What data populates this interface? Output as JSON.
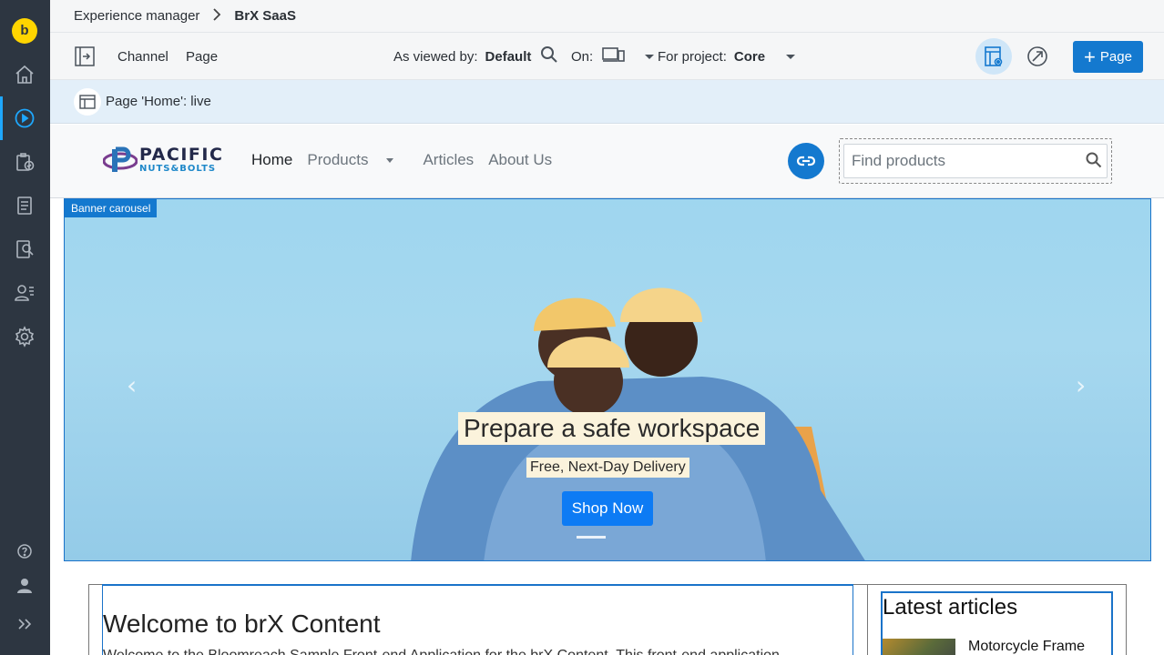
{
  "rail": {
    "logo_letter": "b",
    "items": [
      "home-icon",
      "play-icon",
      "projects-icon",
      "documents-icon",
      "content-search-icon",
      "audiences-icon",
      "settings-icon"
    ],
    "bottom_items": [
      "help-icon",
      "user-icon",
      "expand-icon"
    ]
  },
  "breadcrumb": {
    "root": "Experience manager",
    "current": "BrX SaaS"
  },
  "toolbar": {
    "channel_label": "Channel",
    "page_label": "Page",
    "viewed_by_label": "As viewed by:",
    "viewed_by_value": "Default",
    "on_label": "On:",
    "project_label": "For project:",
    "project_value": "Core",
    "new_page_label": "Page"
  },
  "status": {
    "text": "Page 'Home': live"
  },
  "site": {
    "brand_line1": "PACIFIC",
    "brand_line2": "NUTS&BOLTS",
    "nav": [
      "Home",
      "Products",
      "Articles",
      "About Us"
    ],
    "search_placeholder": "Find products",
    "banner_tag": "Banner carousel",
    "banner_title": "Prepare a safe workspace",
    "banner_subtitle": "Free, Next-Day Delivery",
    "banner_cta": "Shop Now",
    "welcome_title": "Welcome to brX Content",
    "welcome_text": "Welcome to the Bloomreach Sample Front-end Application for the brX Content. This front-end application",
    "latest_title": "Latest articles",
    "latest_first_article": "Motorcycle Frame"
  },
  "colors": {
    "rail_bg": "#2d3641",
    "accent": "#1479cf",
    "logo_yellow": "#ffd500",
    "status_bg": "#e3eff9"
  }
}
